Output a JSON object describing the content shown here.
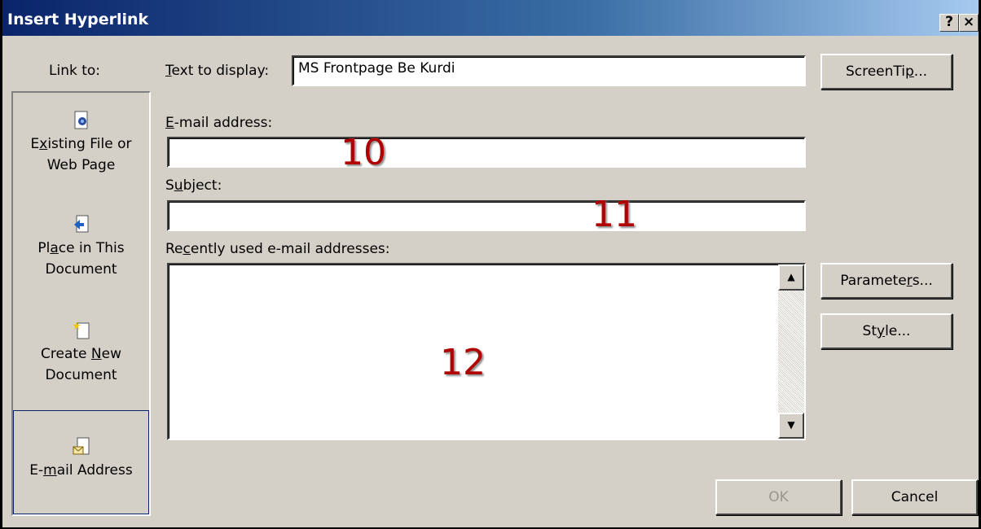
{
  "window": {
    "title": "Insert Hyperlink",
    "help_btn": "?",
    "close_btn": "×"
  },
  "link_to": {
    "label": "Link to:",
    "items": [
      {
        "line1_pre": "E",
        "line1_u": "x",
        "line1_post": "isting File or",
        "line2": "Web Page",
        "icon": "web-page-icon"
      },
      {
        "line1_pre": "Pl",
        "line1_u": "a",
        "line1_post": "ce in This",
        "line2": "Document",
        "icon": "place-in-document-icon"
      },
      {
        "line1_pre": "Create ",
        "line1_u": "N",
        "line1_post": "ew",
        "line2": "Document",
        "icon": "new-document-icon"
      },
      {
        "line1_pre": "E-",
        "line1_u": "m",
        "line1_post": "ail Address",
        "line2": "",
        "icon": "email-address-icon",
        "selected": true
      }
    ]
  },
  "text_to_display": {
    "label_u": "T",
    "label_rest": "ext to display:",
    "value": "MS Frontpage Be Kurdi"
  },
  "email": {
    "label_u": "E",
    "label_rest": "-mail address:",
    "value": ""
  },
  "subject": {
    "label_pre": "S",
    "label_u": "u",
    "label_rest": "bject:",
    "value": ""
  },
  "recent": {
    "label_pre": "Re",
    "label_u": "c",
    "label_rest": "ently used e-mail addresses:"
  },
  "buttons": {
    "screentip_pre": "ScreenTi",
    "screentip_u": "p",
    "screentip_post": "...",
    "parameters_pre": "Paramete",
    "parameters_u": "r",
    "parameters_post": "s...",
    "style_pre": "St",
    "style_u": "y",
    "style_post": "le...",
    "ok": "OK",
    "cancel": "Cancel"
  },
  "annotations": {
    "n10": "10",
    "n11": "11",
    "n12": "12"
  },
  "colors": {
    "titlebar_start": "#0a246a",
    "titlebar_end": "#a6caf0",
    "annotation": "#b00000"
  }
}
